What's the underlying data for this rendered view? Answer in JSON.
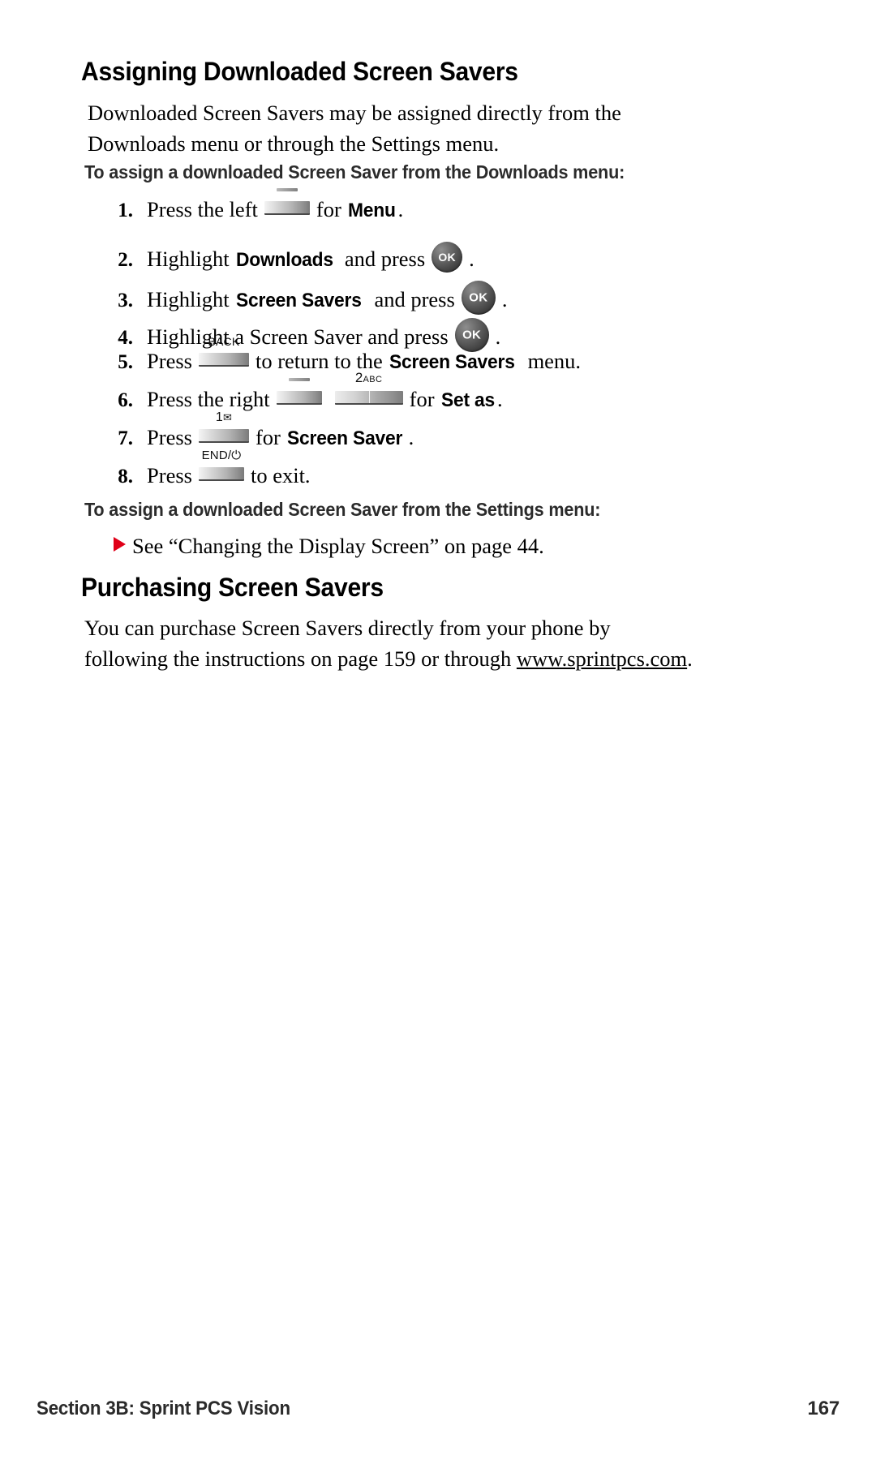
{
  "document": {
    "section_heading": "Assigning Downloaded Screen Savers",
    "intro": {
      "line1": "Downloaded Screen Savers may be assigned directly from the",
      "line2": "Downloads menu or through the Settings menu."
    },
    "subheading_downloads": "To assign a downloaded Screen Saver from the Downloads menu:",
    "steps": [
      {
        "number": "1.",
        "text_before": "Press the left",
        "key": "softkey-left",
        "text_after_1": "for",
        "bold_term": "Menu",
        "text_end": "."
      },
      {
        "number": "2.",
        "text_before": "Highlight",
        "bold_term": "Downloads",
        "text_mid": "and press",
        "key": "ok-button",
        "key_label": "OK",
        "text_end": "."
      },
      {
        "number": "3.",
        "text_before": "Highlight",
        "bold_term": "Screen Savers",
        "text_mid": "and press",
        "key": "ok-button",
        "key_label": "OK",
        "text_end": "."
      },
      {
        "number": "4.",
        "text_before": "Highlight a Screen Saver and press",
        "key": "ok-button",
        "key_label": "OK",
        "text_end": "."
      },
      {
        "number": "5.",
        "text_before": "Press",
        "key": "back-key",
        "key_label": "BACK",
        "text_mid": "to return to the",
        "bold_term": "Screen Savers",
        "text_end": "menu."
      },
      {
        "number": "6.",
        "text_before": "Press the right",
        "key": "softkey-right",
        "key2": "two-abc-key",
        "key2_label_digit": "2",
        "key2_label_letters": "ABC",
        "text_mid": "for",
        "bold_term": "Set as",
        "text_end": "."
      },
      {
        "number": "7.",
        "text_before": "Press",
        "key": "one-key",
        "key_label_digit": "1",
        "key_label_icon": "✉",
        "text_mid": "for",
        "bold_term": "Screen Saver",
        "text_end": "."
      },
      {
        "number": "8.",
        "text_before": "Press",
        "key": "end-key",
        "key_label": "END/⏻",
        "text_mid": "to exit."
      }
    ],
    "subheading_settings": "To assign a downloaded Screen Saver from the Settings menu:",
    "cross_reference": {
      "bullet": "red-triangle",
      "text": "See “Changing the Display Screen” on page 44."
    },
    "purchasing_heading": "Purchasing Screen Savers",
    "purchasing": {
      "line1": "You can purchase Screen Savers directly from your phone by",
      "line2_a": "following the instructions on page 159 or through ",
      "line2_url": "www.sprintpcs.com",
      "line2_b": "."
    },
    "footer": {
      "left": "Section 3B: Sprint PCS Vision",
      "page_number": "167"
    },
    "colors": {
      "text": "#000000",
      "subheading": "#2b2b2b",
      "bullet_red": "#e00018",
      "key_dark": "#3a3a3a"
    }
  }
}
